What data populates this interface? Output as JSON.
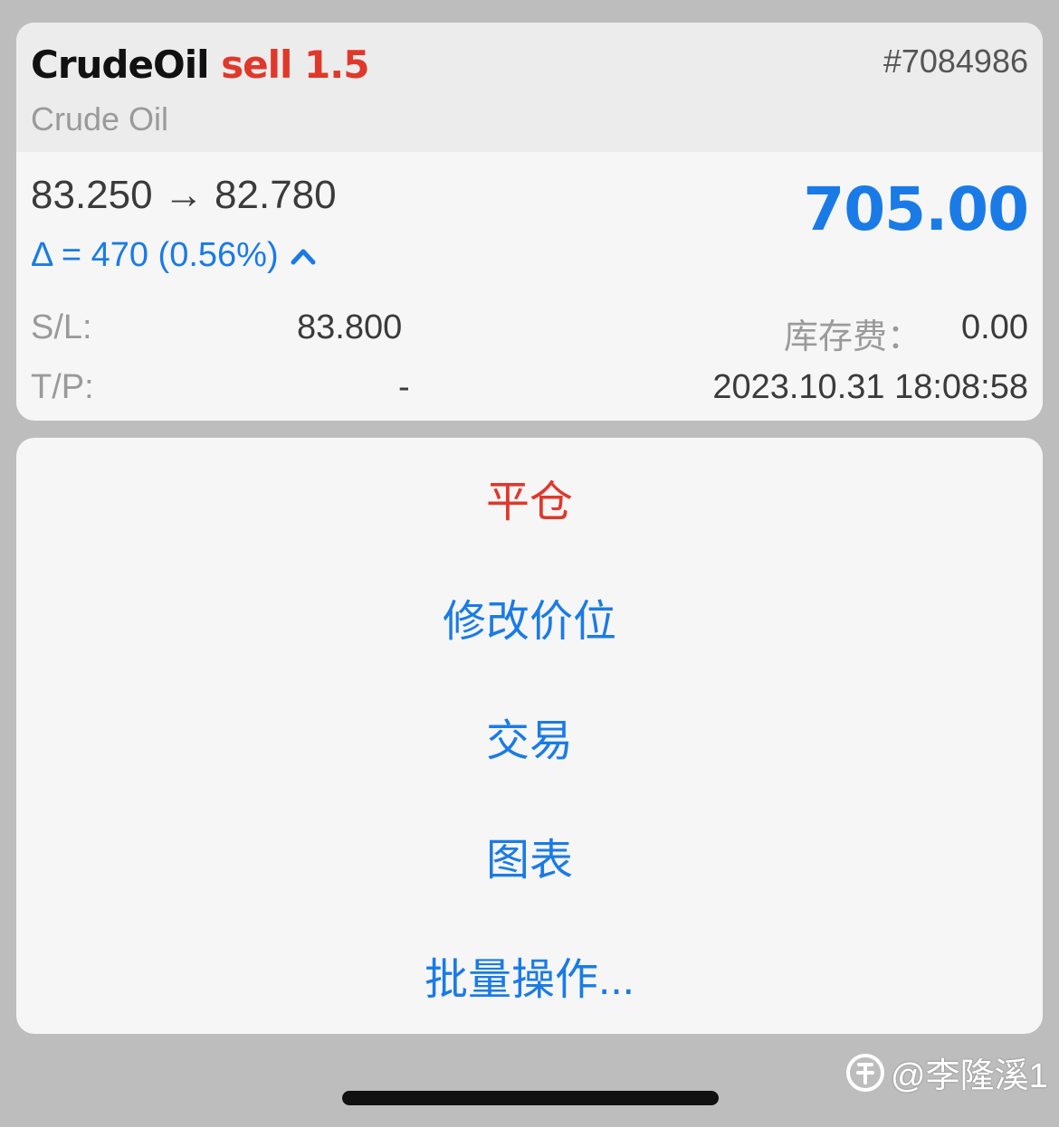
{
  "position": {
    "symbol": "CrudeOil",
    "side": "sell",
    "volume": "1.5",
    "ticket": "#7084986",
    "description": "Crude Oil",
    "open_price": "83.250",
    "arrow": "→",
    "current_price": "82.780",
    "profit": "705.00",
    "delta": "Δ = 470 (0.56%)",
    "sl_label": "S/L:",
    "sl_value": "83.800",
    "tp_label": "T/P:",
    "tp_value": "-",
    "swap_label": "库存费：",
    "swap_value": "0.00",
    "open_time": "2023.10.31 18:08:58"
  },
  "menu": {
    "items": [
      {
        "label": "平仓"
      },
      {
        "label": "修改价位"
      },
      {
        "label": "交易"
      },
      {
        "label": "图表"
      },
      {
        "label": "批量操作..."
      }
    ]
  },
  "watermark": {
    "text": "@李隆溪1",
    "icon": "zhihu-logo-icon"
  },
  "colors": {
    "accent": "#1a7be6",
    "danger": "#e0382b",
    "background": "#bdbdbd"
  }
}
